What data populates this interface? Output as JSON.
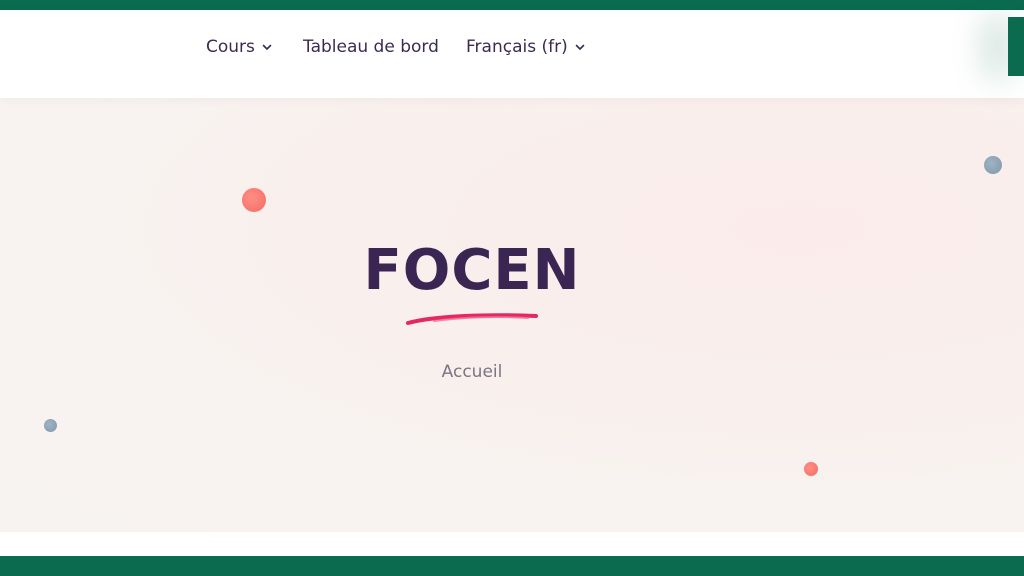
{
  "nav": {
    "items": [
      {
        "label": "Cours",
        "has_dropdown": true
      },
      {
        "label": "Tableau de bord",
        "has_dropdown": false
      },
      {
        "label": "Français (fr)",
        "has_dropdown": true
      }
    ]
  },
  "hero": {
    "title": "FOCEN",
    "breadcrumb": "Accueil"
  },
  "colors": {
    "brand_green": "#0b6b4f",
    "title_purple": "#3b2653",
    "accent_pink": "#e5285f",
    "dot_red": "#f46a60",
    "dot_blue": "#7e97aa"
  },
  "icons": {
    "dropdown": "chevron-down-icon",
    "corner": "side-panel-toggle"
  }
}
